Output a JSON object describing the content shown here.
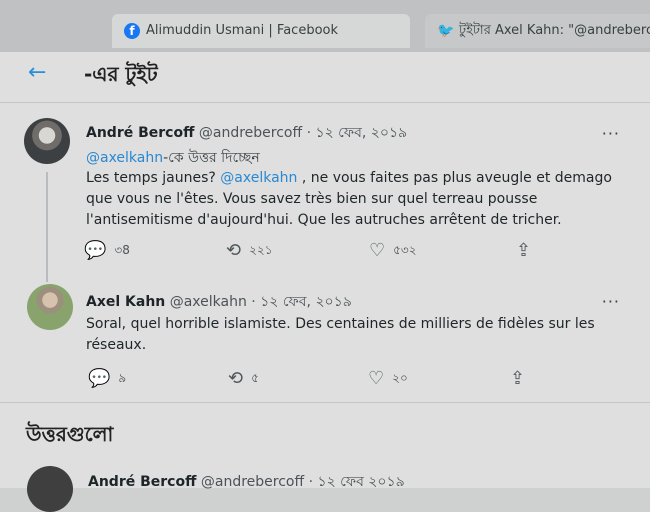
{
  "browser_tabs": [
    {
      "label": "Alimuddin Usmani | Facebook",
      "icon": "facebook-icon"
    },
    {
      "label": "টুইটার Axel Kahn: \"@andrebercoff S",
      "icon": "twitter-bird-icon"
    }
  ],
  "header": {
    "title": "-এর টুইট",
    "back_icon": "back-arrow-icon"
  },
  "tweet_main": {
    "name": "André Bercoff",
    "handle": "@andrebercoff",
    "separator": "·",
    "date": "১২ ফেব, ২০১৯",
    "reply_mention": "@axelkahn",
    "reply_suffix": "-কে উত্তর দিচ্ছেন",
    "text_1": "Les temps jaunes? ",
    "text_mention": "@axelkahn",
    "text_2": " , ne vous faites pas plus aveugle et demago que vous ne l'êtes. Vous savez très bien sur quel terreau pousse l'antisemitisme d'aujourd'hui. Que les autruches arrêtent de tricher.",
    "more": "···",
    "replies": "৩8",
    "retweets": "২২১",
    "likes": "৫৩২"
  },
  "tweet_reply": {
    "name": "Axel Kahn",
    "handle": "@axelkahn",
    "separator": "·",
    "date": "১২ ফেব, ২০১৯",
    "text": "Soral, quel horrible islamiste. Des centaines de milliers de fidèles sur les réseaux.",
    "more": "···",
    "replies": "৯",
    "retweets": "৫",
    "likes": "২০"
  },
  "replies_section": {
    "title": "উত্তরগুলো"
  },
  "tweet_next": {
    "name": "André Bercoff",
    "handle": "@andrebercoff",
    "separator": "·",
    "date": "১২ ফেব ২০১৯"
  }
}
